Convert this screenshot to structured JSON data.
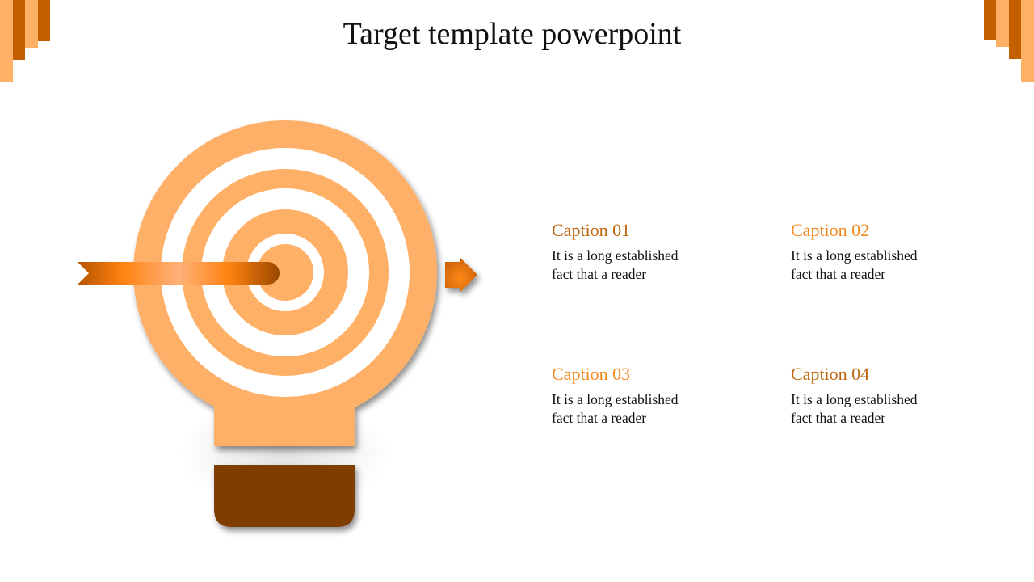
{
  "slide": {
    "title": "Target template powerpoint"
  },
  "colors": {
    "light_orange": "#FFB067",
    "dark_orange": "#C45F00",
    "brown": "#7F3C00",
    "bright_orange": "#FF8210",
    "caption_dark": "#C0650F",
    "caption_bright": "#F08A1E"
  },
  "icons": {
    "target": "bullseye-lightbulb-icon",
    "arrow": "ribbon-arrow-icon",
    "pointer": "right-arrow-icon"
  },
  "captions": [
    {
      "title": "Caption 01",
      "line1": "It is a long established",
      "line2": "fact that a reader",
      "color": "#C0650F"
    },
    {
      "title": "Caption 02",
      "line1": "It is a long established",
      "line2": "fact that a reader",
      "color": "#F08A1E"
    },
    {
      "title": "Caption 03",
      "line1": "It is a long established",
      "line2": "fact that a reader",
      "color": "#F08A1E"
    },
    {
      "title": "Caption 04",
      "line1": "It is a long established",
      "line2": "fact that a reader",
      "color": "#C0650F"
    }
  ]
}
